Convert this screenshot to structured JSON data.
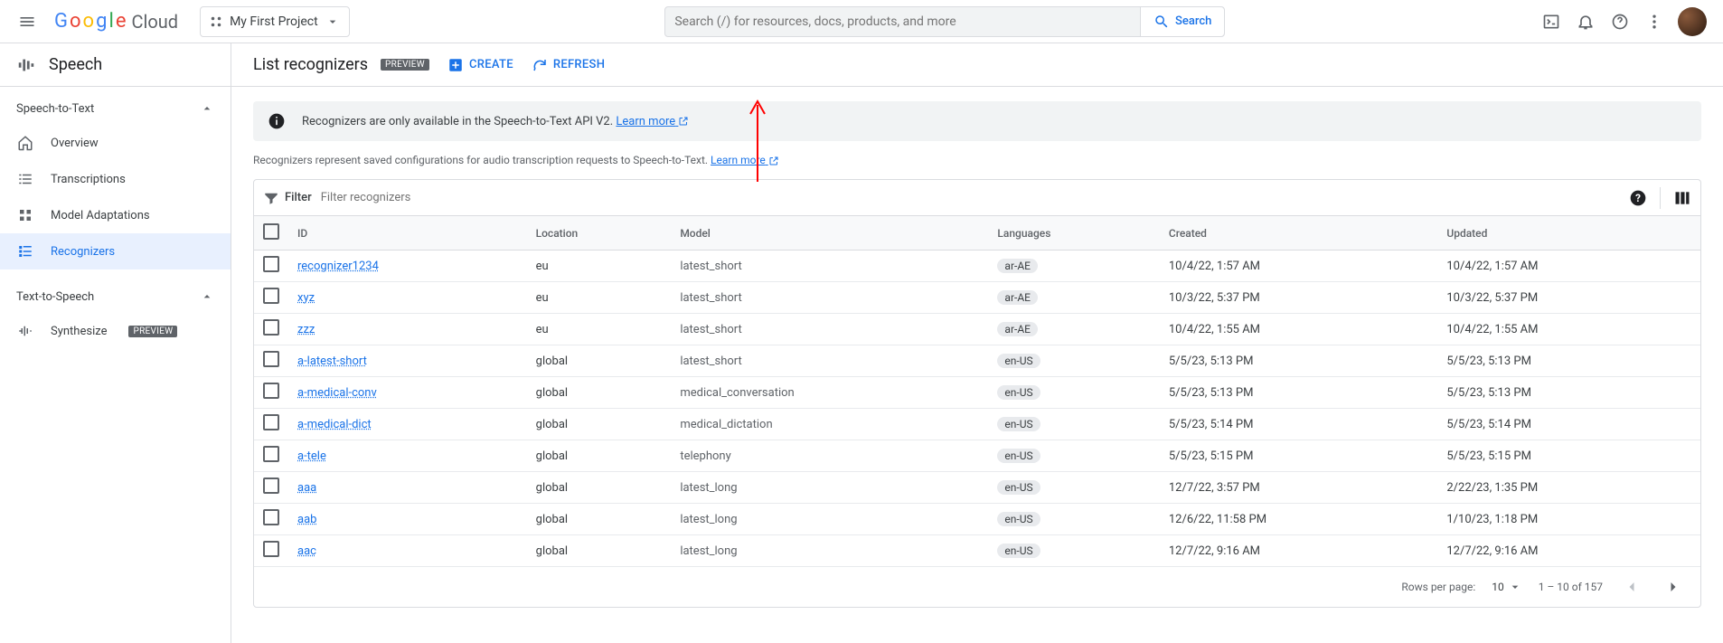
{
  "header": {
    "logo_cloud": "Cloud",
    "project_name": "My First Project",
    "search_placeholder": "Search (/) for resources, docs, products, and more",
    "search_button": "Search"
  },
  "sidebar": {
    "title": "Speech",
    "group1": "Speech-to-Text",
    "items1": [
      "Overview",
      "Transcriptions",
      "Model Adaptations",
      "Recognizers"
    ],
    "group2": "Text-to-Speech",
    "items2": [
      "Synthesize"
    ],
    "preview_chip": "PREVIEW"
  },
  "page": {
    "title": "List recognizers",
    "preview_chip": "PREVIEW",
    "create": "CREATE",
    "refresh": "REFRESH",
    "banner_text": "Recognizers are only available in the Speech-to-Text API V2.",
    "banner_link": "Learn more",
    "desc_text": "Recognizers represent saved configurations for audio transcription requests to Speech-to-Text.",
    "desc_link": "Learn more",
    "filter_label": "Filter",
    "filter_placeholder": "Filter recognizers",
    "columns": [
      "ID",
      "Location",
      "Model",
      "Languages",
      "Created",
      "Updated"
    ],
    "rows": [
      {
        "id": "recognizer1234",
        "loc": "eu",
        "model": "latest_short",
        "lang": "ar-AE",
        "created": "10/4/22, 1:57 AM",
        "updated": "10/4/22, 1:57 AM"
      },
      {
        "id": "xyz",
        "loc": "eu",
        "model": "latest_short",
        "lang": "ar-AE",
        "created": "10/3/22, 5:37 PM",
        "updated": "10/3/22, 5:37 PM"
      },
      {
        "id": "zzz",
        "loc": "eu",
        "model": "latest_short",
        "lang": "ar-AE",
        "created": "10/4/22, 1:55 AM",
        "updated": "10/4/22, 1:55 AM"
      },
      {
        "id": "a-latest-short",
        "loc": "global",
        "model": "latest_short",
        "lang": "en-US",
        "created": "5/5/23, 5:13 PM",
        "updated": "5/5/23, 5:13 PM"
      },
      {
        "id": "a-medical-conv",
        "loc": "global",
        "model": "medical_conversation",
        "lang": "en-US",
        "created": "5/5/23, 5:13 PM",
        "updated": "5/5/23, 5:13 PM"
      },
      {
        "id": "a-medical-dict",
        "loc": "global",
        "model": "medical_dictation",
        "lang": "en-US",
        "created": "5/5/23, 5:14 PM",
        "updated": "5/5/23, 5:14 PM"
      },
      {
        "id": "a-tele",
        "loc": "global",
        "model": "telephony",
        "lang": "en-US",
        "created": "5/5/23, 5:15 PM",
        "updated": "5/5/23, 5:15 PM"
      },
      {
        "id": "aaa",
        "loc": "global",
        "model": "latest_long",
        "lang": "en-US",
        "created": "12/7/22, 3:57 PM",
        "updated": "2/22/23, 1:35 PM"
      },
      {
        "id": "aab",
        "loc": "global",
        "model": "latest_long",
        "lang": "en-US",
        "created": "12/6/22, 11:58 PM",
        "updated": "1/10/23, 1:18 PM"
      },
      {
        "id": "aac",
        "loc": "global",
        "model": "latest_long",
        "lang": "en-US",
        "created": "12/7/22, 9:16 AM",
        "updated": "12/7/22, 9:16 AM"
      }
    ],
    "pager_label": "Rows per page:",
    "pager_size": "10",
    "pager_range": "1 – 10 of 157"
  }
}
